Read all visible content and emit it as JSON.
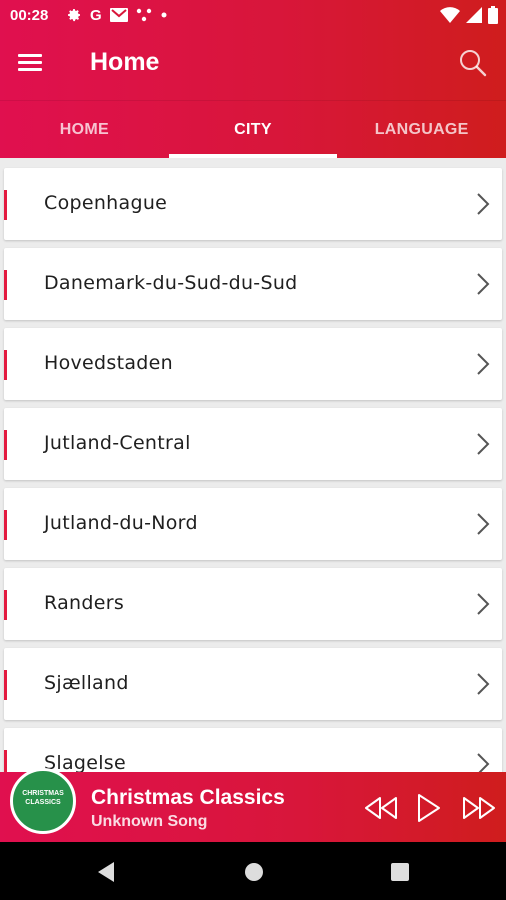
{
  "status": {
    "time": "00:28",
    "g_letter": "G"
  },
  "appbar": {
    "title": "Home"
  },
  "tabs": [
    {
      "label": "HOME"
    },
    {
      "label": "CITY"
    },
    {
      "label": "LANGUAGE"
    }
  ],
  "cities": [
    {
      "label": "Copenhague"
    },
    {
      "label": "Danemark-du-Sud-du-Sud"
    },
    {
      "label": "Hovedstaden"
    },
    {
      "label": "Jutland-Central"
    },
    {
      "label": "Jutland-du-Nord"
    },
    {
      "label": "Randers"
    },
    {
      "label": "Sjælland"
    },
    {
      "label": "Slagelse"
    }
  ],
  "player": {
    "title": "Christmas Classics",
    "subtitle": "Unknown Song",
    "art_text": "CHRISTMAS CLASSICS"
  },
  "colors": {
    "accent": "#e0104f",
    "accent_end": "#cf1d1d",
    "row_marker": "#e31a3f"
  }
}
